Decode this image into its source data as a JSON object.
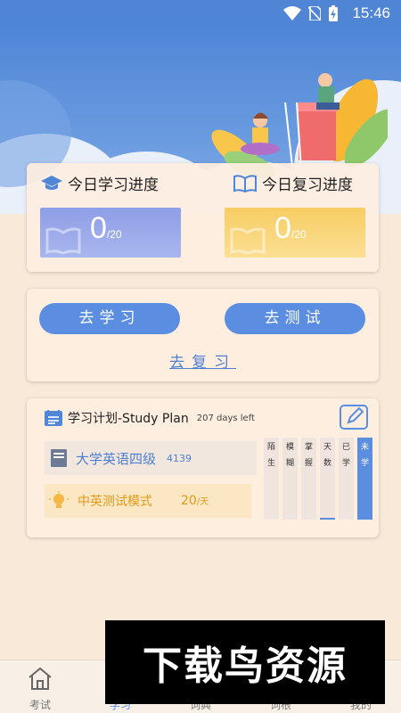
{
  "status_bar": {
    "time": "15:46",
    "icons": [
      "wifi-icon",
      "no-sim-icon",
      "battery-charging-icon"
    ]
  },
  "progress": {
    "learn": {
      "title": "今日学习进度",
      "done": "0",
      "total": "/20",
      "icon": "graduation-cap-icon"
    },
    "review": {
      "title": "今日复习进度",
      "done": "0",
      "total": "/20",
      "icon": "open-book-icon"
    }
  },
  "actions": {
    "learn_label": "去学习",
    "test_label": "去测试",
    "review_label": "去复习"
  },
  "plan": {
    "title": "学习计划-Study Plan",
    "days_left": "207 days left",
    "book": {
      "name": "大学英语四级",
      "count": "4139"
    },
    "mode": {
      "name": "中英测试模式",
      "rate": "20",
      "unit": "/天"
    },
    "levels": [
      {
        "label": "陌生",
        "ratio": 0
      },
      {
        "label": "模糊",
        "ratio": 0
      },
      {
        "label": "掌握",
        "ratio": 0
      },
      {
        "label": "天数",
        "ratio": 0.02
      },
      {
        "label": "已学",
        "ratio": 0
      },
      {
        "label": "未学",
        "ratio": 1
      }
    ]
  },
  "nav": [
    {
      "label": "考试",
      "icon": "home-icon"
    },
    {
      "label": "学习",
      "icon": "study-icon"
    },
    {
      "label": "词典",
      "icon": "dictionary-icon"
    },
    {
      "label": "词根",
      "icon": "root-icon"
    },
    {
      "label": "我的",
      "icon": "profile-icon"
    }
  ],
  "nav_active_index": 1,
  "watermark": "下载鸟资源",
  "colors": {
    "accent": "#5b8ee0",
    "sky": "#4f86d6",
    "background": "#f8e9d9",
    "mode": "#e29a17"
  }
}
